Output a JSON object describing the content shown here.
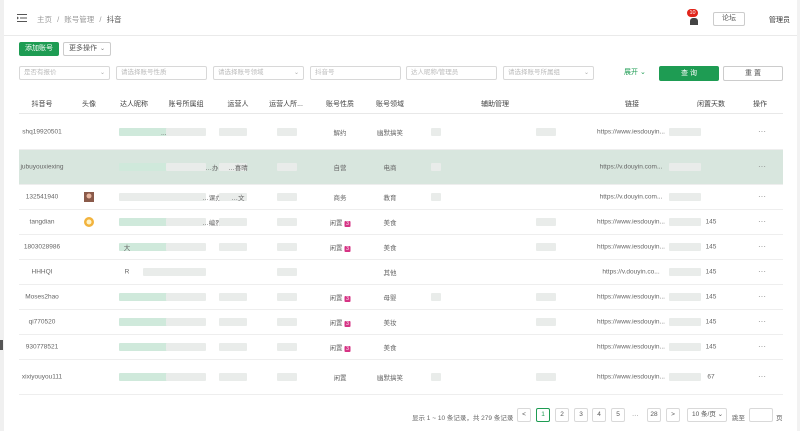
{
  "header": {
    "breadcrumb": [
      "主页",
      "/",
      "账号管理",
      "/",
      "抖音"
    ],
    "notifications_count": "10",
    "forum_button": "论坛",
    "user": "管理员"
  },
  "toolbar": {
    "add_button": "添加账号",
    "more_actions": "更多操作"
  },
  "filters": {
    "f1": "是否有报价",
    "f2": "请选择账号性质",
    "f3": "请选择账号领域",
    "f4": "抖音号",
    "f5": "达人昵称/管理员",
    "f6": "请选择账号所属组",
    "expand": "展开",
    "query": "查 询",
    "reset": "重 置"
  },
  "table": {
    "columns": [
      "抖音号",
      "头像",
      "达人昵称",
      "账号所属组",
      "运营人",
      "运营人所...",
      "账号性质",
      "账号领域",
      "辅助管理",
      "链接",
      "闲置天数",
      "操作"
    ],
    "rows": [
      {
        "id": "shq19920501",
        "nick": "...人",
        "group": "",
        "op": "",
        "nature": "解约",
        "tag": "",
        "domain": "幽默搞笑",
        "link": "https://www.iesdouyin...",
        "idle": "",
        "more": "···"
      },
      {
        "id": "jubuyouxiexing",
        "nick": "",
        "group": "…办",
        "op": "…喜晴",
        "nature": "自营",
        "tag": "",
        "domain": "电商",
        "link": "https://v.douyin.com...",
        "idle": "",
        "more": "···"
      },
      {
        "id": "132541940",
        "nick": "",
        "group": "…课办",
        "op": "…文",
        "nature": "商务",
        "tag": "",
        "domain": "教育",
        "link": "https://v.douyin.com...",
        "idle": "",
        "more": "···"
      },
      {
        "id": "tangdian",
        "nick": "",
        "group": "…编烈",
        "op": "",
        "nature": "闲置",
        "tag": "3",
        "domain": "美食",
        "link": "https://www.iesdouyin...",
        "idle": "145",
        "more": "···"
      },
      {
        "id": "1803028986",
        "nick": "大",
        "group": "",
        "op": "",
        "nature": "闲置",
        "tag": "3",
        "domain": "美食",
        "link": "https://www.iesdouyin...",
        "idle": "145",
        "more": "···"
      },
      {
        "id": "HHHQI",
        "nick": "R",
        "group": "",
        "op": "",
        "nature": "",
        "tag": "",
        "domain": "其他",
        "link": "https://v.douyin.co...",
        "idle": "145",
        "more": "···"
      },
      {
        "id": "Moses2hao",
        "nick": "",
        "group": "",
        "op": "",
        "nature": "闲置",
        "tag": "3",
        "domain": "母婴",
        "link": "https://www.iesdouyin...",
        "idle": "145",
        "more": "···"
      },
      {
        "id": "qi770520",
        "nick": "",
        "group": "",
        "op": "",
        "nature": "闲置",
        "tag": "3",
        "domain": "美妆",
        "link": "https://www.iesdouyin...",
        "idle": "145",
        "more": "···"
      },
      {
        "id": "930778521",
        "nick": "",
        "group": "",
        "op": "",
        "nature": "闲置",
        "tag": "3",
        "domain": "美食",
        "link": "https://www.iesdouyin...",
        "idle": "145",
        "more": "···"
      },
      {
        "id": "xixiyouyou111",
        "nick": "",
        "group": "",
        "op": "",
        "nature": "闲置",
        "tag": "",
        "domain": "幽默搞笑",
        "link": "https://www.iesdouyin...",
        "idle": "67",
        "more": "···"
      }
    ]
  },
  "pagination": {
    "summary": "显示 1 ~ 10 条记录，共 279 条记录",
    "prev": "<",
    "pages": [
      "1",
      "2",
      "3",
      "4",
      "5"
    ],
    "ellipsis": "···",
    "last": "28",
    "next": ">",
    "page_size": "10 条/页",
    "jump_label": "跳至",
    "jump_suffix": "页"
  },
  "colors": {
    "accent": "#1e9c53",
    "highlight_row": "#d8e6de",
    "badge": "#e1251b",
    "tag": "#d63384"
  }
}
